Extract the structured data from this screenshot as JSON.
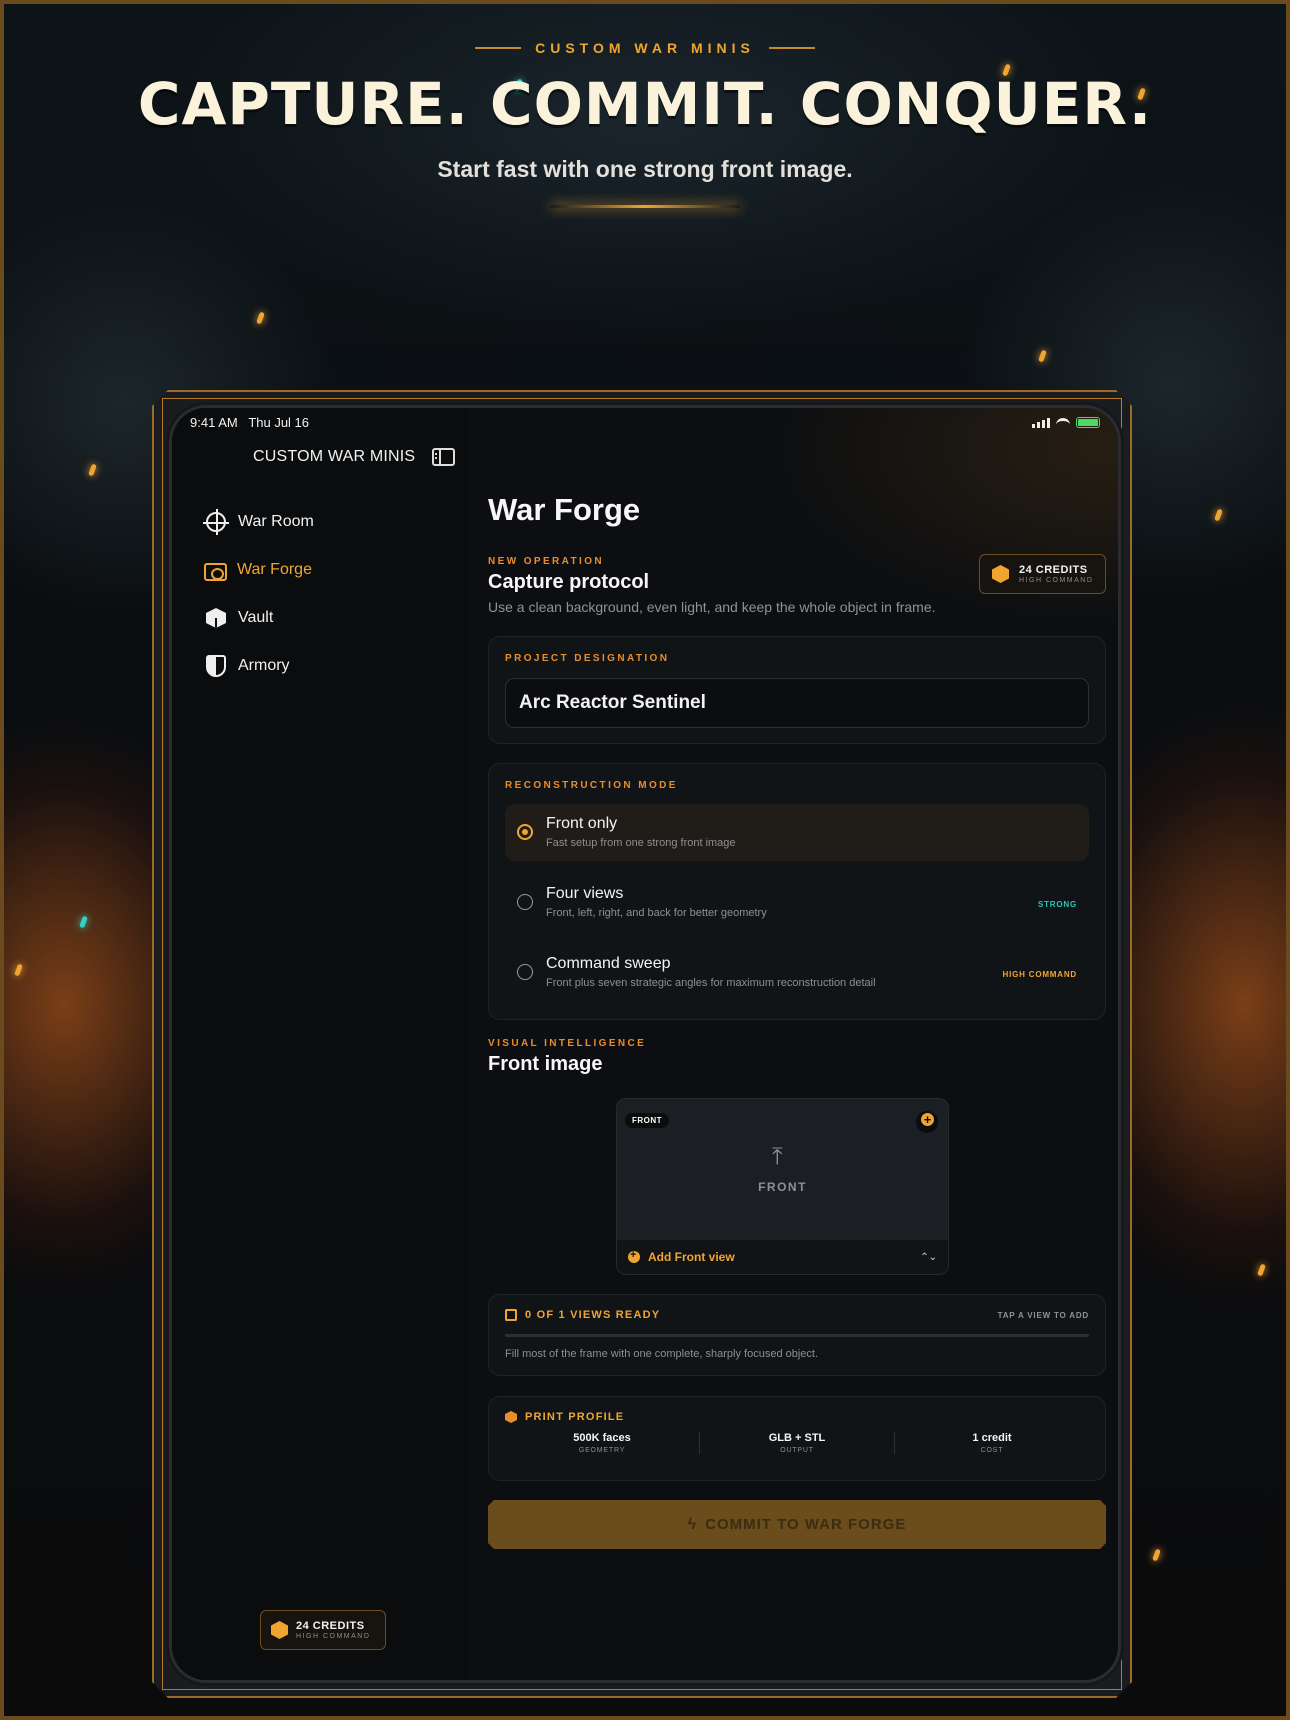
{
  "hero": {
    "eyebrow": "CUSTOM WAR MINIS",
    "title": "CAPTURE. COMMIT. CONQUER.",
    "subtitle": "Start fast with one strong front image."
  },
  "status_bar": {
    "time": "9:41 AM",
    "date": "Thu Jul 16"
  },
  "sidebar": {
    "app_title": "CUSTOM WAR MINIS",
    "items": [
      {
        "label": "War Room",
        "icon": "crosshair-icon",
        "active": false
      },
      {
        "label": "War Forge",
        "icon": "forge-icon",
        "active": true
      },
      {
        "label": "Vault",
        "icon": "cube-icon",
        "active": false
      },
      {
        "label": "Armory",
        "icon": "shield-icon",
        "active": false
      }
    ],
    "credits": {
      "amount": "24 CREDITS",
      "tier": "HIGH COMMAND"
    }
  },
  "main": {
    "page_title": "War Forge",
    "operation": {
      "kicker": "NEW OPERATION",
      "title": "Capture protocol",
      "description": "Use a clean background, even light, and keep the whole object in frame."
    },
    "credits": {
      "amount": "24 CREDITS",
      "tier": "HIGH COMMAND"
    },
    "project": {
      "label": "PROJECT DESIGNATION",
      "value": "Arc Reactor Sentinel"
    },
    "mode": {
      "label": "RECONSTRUCTION MODE",
      "options": [
        {
          "title": "Front only",
          "description": "Fast setup from one strong front image",
          "tag": "",
          "selected": true
        },
        {
          "title": "Four views",
          "description": "Front, left, right, and back for better geometry",
          "tag": "STRONG",
          "selected": false
        },
        {
          "title": "Command sweep",
          "description": "Front plus seven strategic angles for maximum reconstruction detail",
          "tag": "HIGH COMMAND",
          "selected": false
        }
      ]
    },
    "visual": {
      "kicker": "VISUAL INTELLIGENCE",
      "title": "Front image",
      "upload": {
        "badge": "FRONT",
        "center_label": "FRONT",
        "footer": "Add Front view"
      }
    },
    "ready": {
      "status": "0 OF 1 VIEWS READY",
      "hint": "TAP A VIEW TO ADD",
      "progress": 0,
      "description": "Fill most of the frame with one complete, sharply focused object."
    },
    "print_profile": {
      "label": "PRINT PROFILE",
      "stats": [
        {
          "value": "500K faces",
          "label": "GEOMETRY"
        },
        {
          "value": "GLB + STL",
          "label": "OUTPUT"
        },
        {
          "value": "1 credit",
          "label": "COST"
        }
      ]
    },
    "commit_label": "COMMIT TO WAR FORGE"
  },
  "colors": {
    "accent": "#f0a531",
    "strong_tag": "#2ec4b6",
    "high_command_tag": "#f0a531"
  }
}
